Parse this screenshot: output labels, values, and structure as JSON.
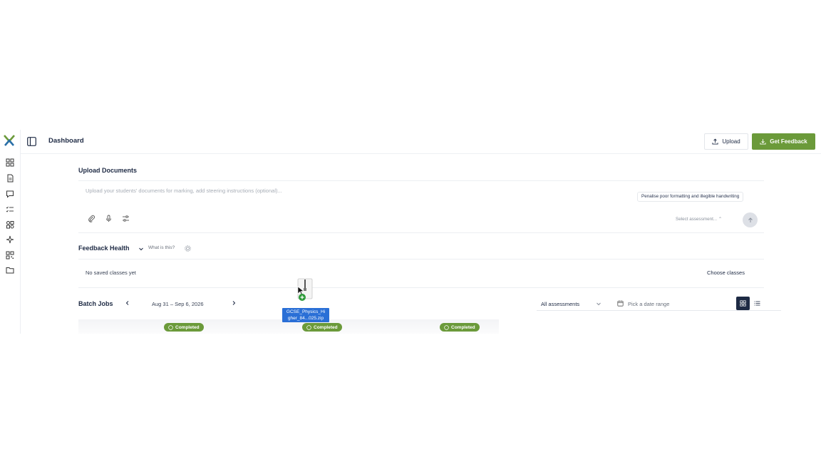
{
  "header": {
    "title": "Dashboard",
    "upload_label": "Upload",
    "feedback_label": "Get Feedback"
  },
  "sidebar": {
    "items": [
      {
        "icon": "grid-icon"
      },
      {
        "icon": "document-icon"
      },
      {
        "icon": "chat-icon"
      },
      {
        "icon": "checklist-icon"
      },
      {
        "icon": "apps-icon"
      },
      {
        "icon": "sparkle-icon"
      },
      {
        "icon": "qr-icon"
      },
      {
        "icon": "folder-icon"
      }
    ]
  },
  "upload": {
    "title": "Upload Documents",
    "placeholder": "Upload your students' documents for marking, add steering instructions (optional)...",
    "chip": "Penalise poor formatting and illegible handwriting",
    "select_assessment": "Select assessment...",
    "tools": [
      "paperclip-icon",
      "microphone-icon",
      "sliders-icon"
    ]
  },
  "feedback_health": {
    "title": "Feedback Health",
    "what_is_this": "What is this?",
    "empty": "No saved classes yet",
    "choose": "Choose classes"
  },
  "batch_jobs": {
    "title": "Batch Jobs",
    "date_range": "Aug 31 – Sep 6, 2026",
    "filter": "All assessments",
    "date_picker": "Pick a date range",
    "statuses": [
      "Completed",
      "Completed",
      "Completed"
    ]
  },
  "drag": {
    "filename_line1": "GCSE_Physics_Hi",
    "filename_line2": "gher_84...025.zip"
  },
  "colors": {
    "brand_green": "#6b9a3a",
    "navy": "#1e2a44"
  }
}
